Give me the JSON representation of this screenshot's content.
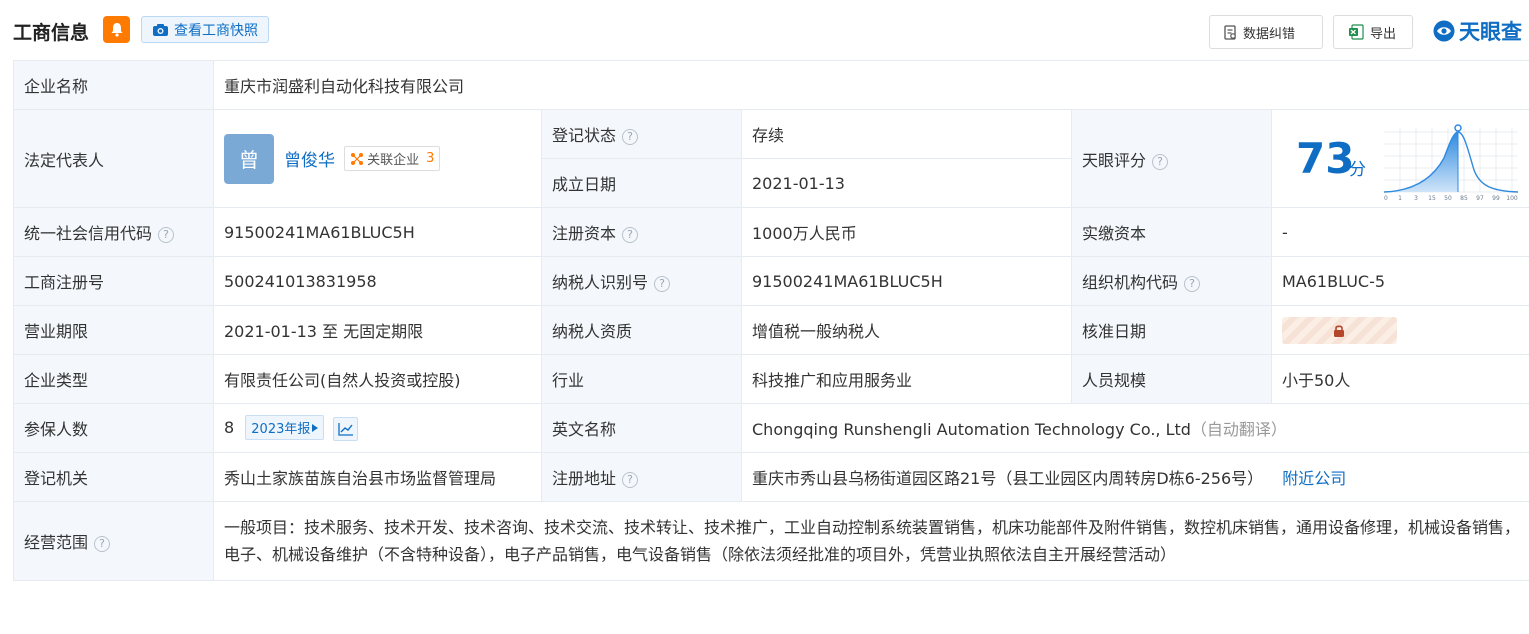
{
  "header": {
    "title": "工商信息",
    "snapshot_label": "查看工商快照",
    "correct_label": "数据纠错",
    "export_label": "导出",
    "logo_text": "天眼查"
  },
  "rows": {
    "company_name": {
      "label": "企业名称",
      "value": "重庆市润盛利自动化科技有限公司"
    },
    "legal_rep": {
      "label": "法定代表人",
      "avatar": "曾",
      "name": "曾俊华",
      "related_label": "关联企业",
      "related_count": "3"
    },
    "reg_status": {
      "label": "登记状态",
      "value": "存续"
    },
    "found_date": {
      "label": "成立日期",
      "value": "2021-01-13"
    },
    "tianyan_score": {
      "label": "天眼评分",
      "score": "73",
      "unit": "分",
      "axis_ticks": [
        "0",
        "1",
        "3",
        "15",
        "50",
        "85",
        "97",
        "99",
        "100"
      ]
    },
    "credit_code": {
      "label": "统一社会信用代码",
      "value": "91500241MA61BLUC5H"
    },
    "reg_capital": {
      "label": "注册资本",
      "value": "1000万人民币"
    },
    "paid_capital": {
      "label": "实缴资本",
      "value": "-"
    },
    "reg_number": {
      "label": "工商注册号",
      "value": "500241013831958"
    },
    "taxpayer_id": {
      "label": "纳税人识别号",
      "value": "91500241MA61BLUC5H"
    },
    "org_code": {
      "label": "组织机构代码",
      "value": "MA61BLUC-5"
    },
    "business_term": {
      "label": "营业期限",
      "value": "2021-01-13 至 无固定期限"
    },
    "taxpayer_qual": {
      "label": "纳税人资质",
      "value": "增值税一般纳税人"
    },
    "approval_date": {
      "label": "核准日期"
    },
    "company_type": {
      "label": "企业类型",
      "value": "有限责任公司(自然人投资或控股)"
    },
    "industry": {
      "label": "行业",
      "value": "科技推广和应用服务业"
    },
    "staff_size": {
      "label": "人员规模",
      "value": "小于50人"
    },
    "insured": {
      "label": "参保人数",
      "value": "8",
      "report_label": "2023年报"
    },
    "english_name": {
      "label": "英文名称",
      "value": "Chongqing Runshengli Automation Technology Co., Ltd",
      "note": "（自动翻译）"
    },
    "reg_authority": {
      "label": "登记机关",
      "value": "秀山土家族苗族自治县市场监督管理局"
    },
    "reg_address": {
      "label": "注册地址",
      "value": "重庆市秀山县乌杨街道园区路21号（县工业园区内周转房D栋6-256号）",
      "nearby_label": "附近公司"
    },
    "business_scope": {
      "label": "经营范围",
      "value": "一般项目：技术服务、技术开发、技术咨询、技术交流、技术转让、技术推广，工业自动控制系统装置销售，机床功能部件及附件销售，数控机床销售，通用设备修理，机械设备销售，电子、机械设备维护（不含特种设备），电子产品销售，电气设备销售（除依法须经批准的项目外，凭营业执照依法自主开展经营活动）"
    }
  },
  "colors": {
    "accent": "#0f6ec4",
    "status_green": "#00a36a",
    "orange": "#ff7a00",
    "label_bg": "#f4f8fc"
  }
}
